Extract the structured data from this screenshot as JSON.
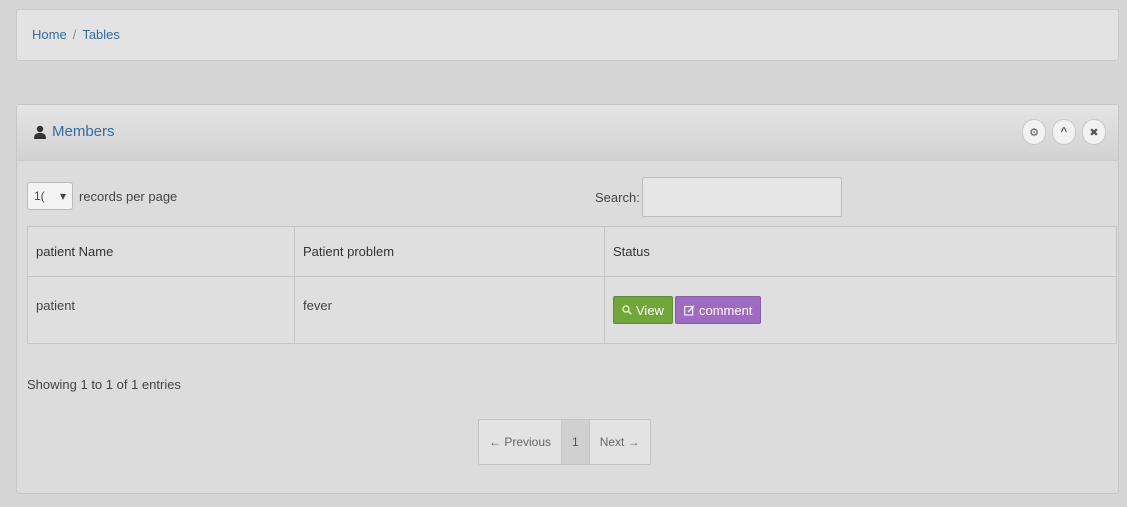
{
  "breadcrumb": {
    "home": "Home",
    "separator": "/",
    "current": "Tables"
  },
  "panel": {
    "title": "Members",
    "title_icon": "user-icon",
    "actions": [
      {
        "name": "settings",
        "glyph": "⚙",
        "icon": "gear-icon"
      },
      {
        "name": "collapse",
        "glyph": "^",
        "icon": "chevron-up-icon"
      },
      {
        "name": "close",
        "glyph": "✖",
        "icon": "close-icon"
      }
    ]
  },
  "controls": {
    "per_page_value": "1(",
    "per_page_label": "records per page",
    "search_label": "Search:",
    "search_value": ""
  },
  "table": {
    "headers": [
      "patient Name",
      "Patient problem",
      "Status"
    ],
    "rows": [
      {
        "name": "patient",
        "problem": "fever",
        "view_label": "View",
        "comment_label": "comment"
      }
    ]
  },
  "info": "Showing 1 to 1 of 1 entries",
  "pagination": {
    "previous": "← Previous",
    "current": "1",
    "next": "Next →"
  },
  "colors": {
    "link": "#2f6fa3",
    "view": "#6fa73a",
    "comment": "#9f6bc2"
  }
}
